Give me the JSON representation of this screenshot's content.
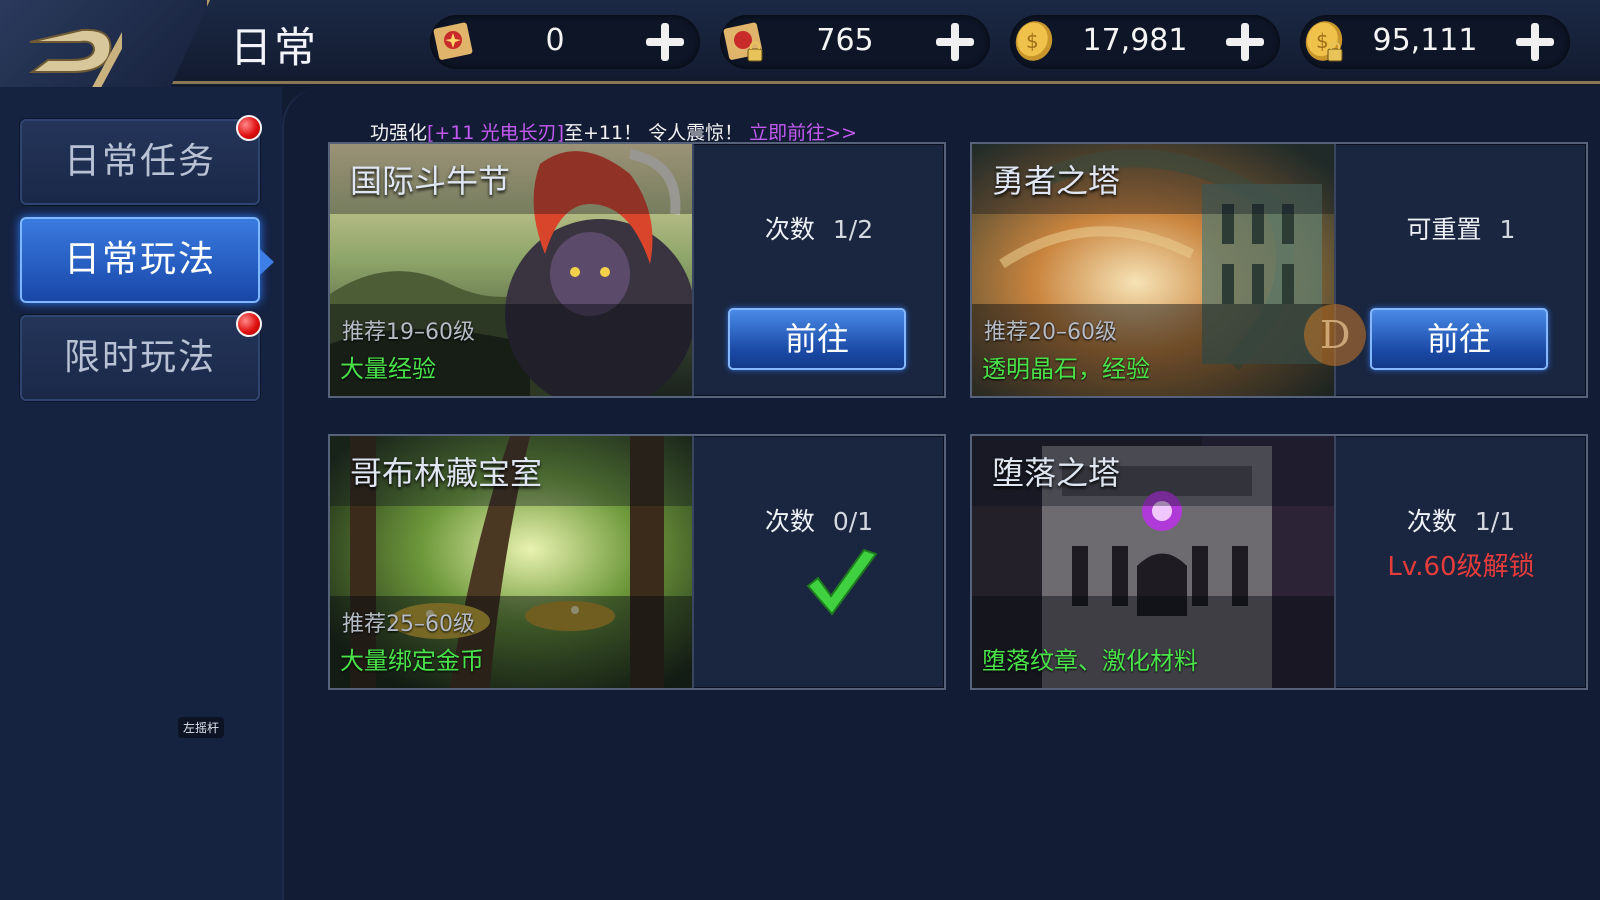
{
  "header": {
    "title": "日常",
    "resources": [
      {
        "name": "treasure-map",
        "value": "0",
        "icon": "red-scroll-icon"
      },
      {
        "name": "locked-treasure-map",
        "value": "765",
        "icon": "locked-scroll-icon"
      },
      {
        "name": "gold",
        "value": "17,981",
        "icon": "gold-coin-icon"
      },
      {
        "name": "bound-gold",
        "value": "95,111",
        "icon": "locked-gold-coin-icon"
      }
    ]
  },
  "sidebar": {
    "tabs": [
      {
        "label": "日常任务",
        "active": false,
        "red_dot": true
      },
      {
        "label": "日常玩法",
        "active": true,
        "red_dot": false
      },
      {
        "label": "限时玩法",
        "active": false,
        "red_dot": true
      }
    ],
    "joystick_label": "左摇杆"
  },
  "marquee": {
    "prefix": "功强化",
    "item": "[+11 光电长刃]",
    "middle": "至+11！ 令人震惊！ ",
    "link": "立即前往>>"
  },
  "cards": [
    {
      "title": "国际斗牛节",
      "recommend": "推荐19–60级",
      "reward": "大量经验",
      "count_label": "次数",
      "count_value": "1/2",
      "button": "前往"
    },
    {
      "title": "勇者之塔",
      "recommend": "推荐20–60级",
      "reward": "透明晶石，经验",
      "count_label": "可重置",
      "count_value": "1",
      "button": "前往"
    },
    {
      "title": "哥布林藏宝室",
      "recommend": "推荐25–60级",
      "reward": "大量绑定金币",
      "count_label": "次数",
      "count_value": "0/1",
      "completed": true
    },
    {
      "title": "堕落之塔",
      "reward": "堕落纹章、激化材料",
      "count_label": "次数",
      "count_value": "1/1",
      "lock_text": "Lv.60级解锁"
    }
  ],
  "colors": {
    "accent_blue": "#2d6fd8",
    "reward_green": "#49e349",
    "lock_red": "#e53b3b",
    "highlight_purple": "#c45af2",
    "gold_trim": "#b89c66"
  }
}
